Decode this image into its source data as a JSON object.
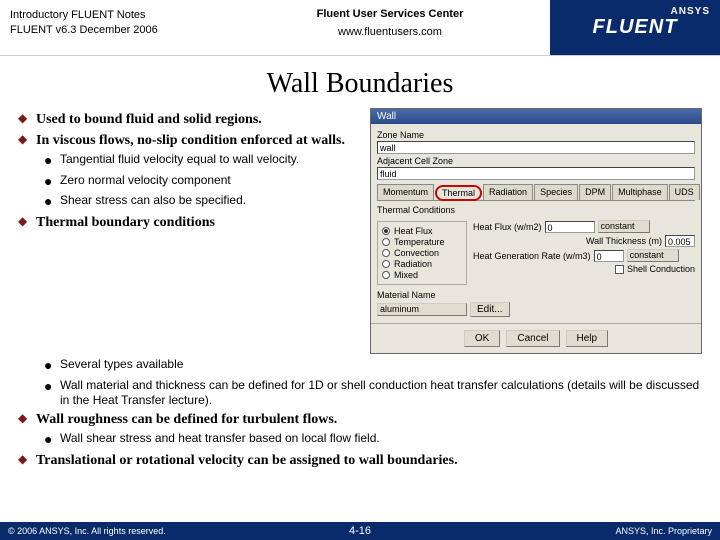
{
  "header": {
    "notes_line1": "Introductory FLUENT Notes",
    "notes_line2": "FLUENT v6.3 December 2006",
    "center_title": "Fluent User Services Center",
    "center_url": "www.fluentusers.com",
    "brand_top": "ANSYS",
    "brand_main": "FLUENT"
  },
  "title": "Wall Boundaries",
  "bullets": {
    "b1": "Used to bound fluid and solid regions.",
    "b2": "In viscous flows, no-slip condition enforced at walls.",
    "b2s1": "Tangential fluid velocity equal to wall velocity.",
    "b2s2": "Zero normal velocity component",
    "b2s3": "Shear stress can also be specified.",
    "b3": "Thermal boundary conditions",
    "b3s1": "Several types available",
    "b3s2": "Wall material and thickness can be defined for 1D or shell conduction heat transfer calculations (details will be discussed in the Heat Transfer lecture).",
    "b4": "Wall roughness can be defined for turbulent flows.",
    "b4s1": "Wall shear stress and heat transfer based on local flow field.",
    "b5": "Translational or rotational velocity can be assigned to wall boundaries."
  },
  "dialog": {
    "title": "Wall",
    "zone_name_lbl": "Zone Name",
    "zone_name": "wall",
    "adj_lbl": "Adjacent Cell Zone",
    "adj": "fluid",
    "tabs": [
      "Momentum",
      "Thermal",
      "Radiation",
      "Species",
      "DPM",
      "Multiphase",
      "UDS"
    ],
    "tc_title": "Thermal Conditions",
    "radios": [
      "Heat Flux",
      "Temperature",
      "Convection",
      "Radiation",
      "Mixed"
    ],
    "hf_lbl": "Heat Flux (w/m2)",
    "hf_val": "0",
    "hf_sel": "constant",
    "wt_lbl": "Wall Thickness (m)",
    "wt_val": "0.005",
    "hg_lbl": "Heat Generation Rate (w/m3)",
    "hg_val": "0",
    "hg_sel": "constant",
    "shell_lbl": "Shell Conduction",
    "mat_lbl": "Material Name",
    "mat_val": "aluminum",
    "edit": "Edit...",
    "ok": "OK",
    "cancel": "Cancel",
    "help": "Help"
  },
  "footer": {
    "left": "© 2006 ANSYS, Inc. All rights reserved.",
    "page": "4-16",
    "right": "ANSYS, Inc. Proprietary"
  }
}
